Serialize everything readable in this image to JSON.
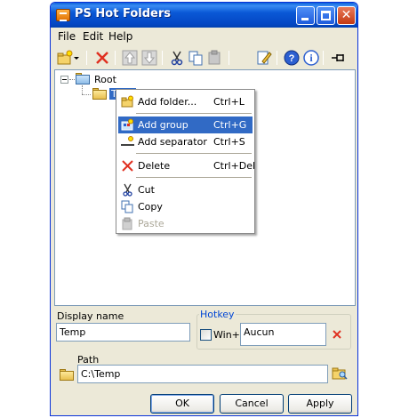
{
  "window": {
    "title": "PS Hot Folders"
  },
  "menu": {
    "file": "File",
    "edit": "Edit",
    "help": "Help"
  },
  "toolbar": {
    "icons": [
      "new-folder-icon",
      "dropdown-arrow-icon",
      "delete-icon",
      "move-up-icon",
      "move-down-icon",
      "cut-icon",
      "copy-icon",
      "paste-icon",
      "edit-icon",
      "help-icon",
      "info-icon",
      "pin-icon"
    ]
  },
  "tree": {
    "root_label": "Root",
    "child_label": "Temp"
  },
  "context_menu": {
    "items": [
      {
        "label": "Add folder...",
        "shortcut": "Ctrl+L"
      },
      {
        "label": "Add group",
        "shortcut": "Ctrl+G"
      },
      {
        "label": "Add separator",
        "shortcut": "Ctrl+S"
      },
      {
        "label": "Delete",
        "shortcut": "Ctrl+Del"
      },
      {
        "label": "Cut",
        "shortcut": ""
      },
      {
        "label": "Copy",
        "shortcut": ""
      },
      {
        "label": "Paste",
        "shortcut": ""
      }
    ]
  },
  "form": {
    "display_name_label": "Display name",
    "display_name_value": "Temp",
    "hotkey_label": "Hotkey",
    "win_label": "Win+",
    "hotkey_value": "Aucun",
    "path_label": "Path",
    "path_value": "C:\\Temp"
  },
  "buttons": {
    "ok": "OK",
    "cancel": "Cancel",
    "apply": "Apply"
  },
  "colors": {
    "title_blue": "#0a58d6",
    "selection": "#316ac5",
    "dialog_bg": "#ece9d8",
    "delete_red": "#e03020"
  }
}
